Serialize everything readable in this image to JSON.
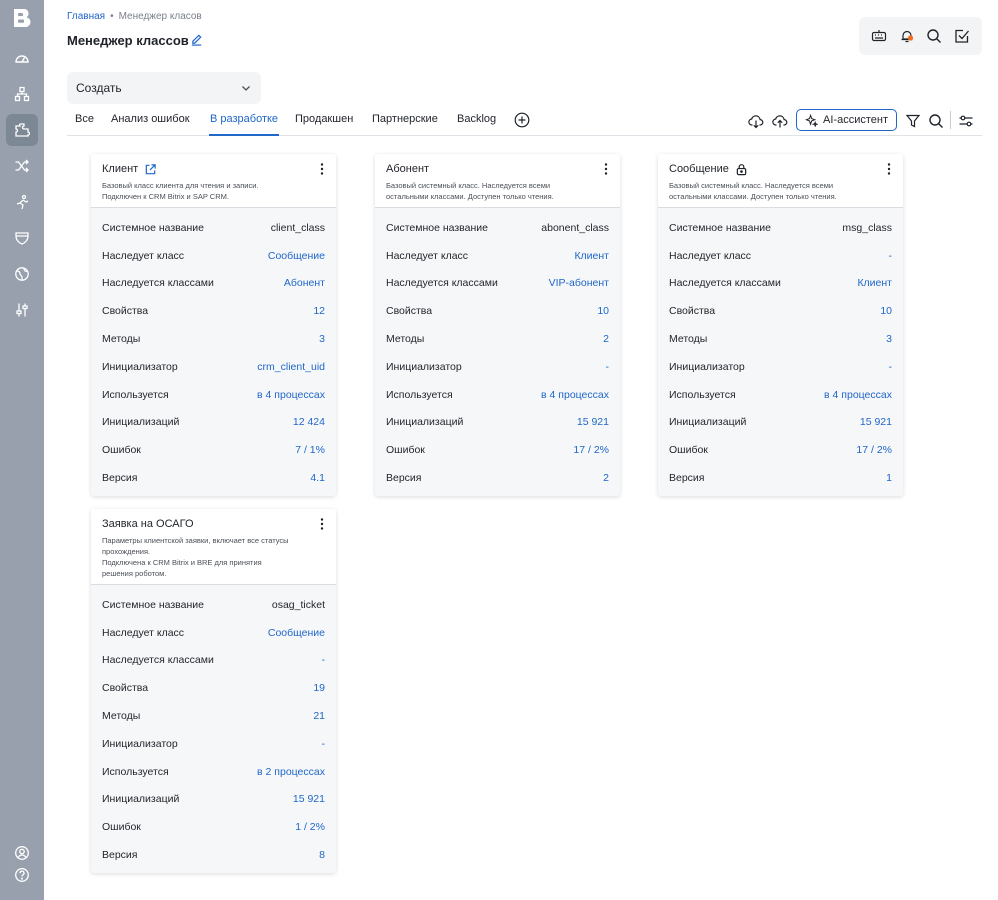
{
  "breadcrumb": {
    "home": "Главная",
    "separator": "•",
    "current": "Менеджер класов"
  },
  "page": {
    "title": "Менеджер классов"
  },
  "create": {
    "label": "Создать"
  },
  "tabs": [
    "Все",
    "Анализ ошибок",
    "В разработке",
    "Продакшен",
    "Партнерские",
    "Backlog"
  ],
  "active_tab": "В разработке",
  "toolbar": {
    "ai_label": "AI-ассистент"
  },
  "icons": {
    "sidebar": [
      "dashboard-icon",
      "structure-icon",
      "classes-icon",
      "shuffle-icon",
      "process-icon",
      "database-icon",
      "globe-icon",
      "settings-sliders-icon",
      "user-icon",
      "help-icon"
    ],
    "top": [
      "keyboard-icon",
      "notification-bell-icon",
      "search-icon",
      "task-check-icon"
    ]
  },
  "colors": {
    "accent": "#2067c9",
    "sidebar": "#97a0ac",
    "notification": "#f26b1d"
  },
  "row_labels": [
    "Системное название",
    "Наследует класс",
    "Наследуется классами",
    "Свойства",
    "Методы",
    "Инициализатор",
    "Используется",
    "Инициализаций",
    "Ошибок",
    "Версия"
  ],
  "cards": [
    {
      "title": "Клиент",
      "title_icon": "external-link-icon",
      "description": [
        "Базовый класс клиента для чтения и записи.",
        "Подключен к CRM Bitrix и SAP CRM."
      ],
      "values": [
        "client_class",
        "Сообщение",
        "Абонент",
        "12",
        "3",
        "crm_client_uid",
        "в 4 процессах",
        "12 424",
        "7 / 1%",
        "4.1"
      ]
    },
    {
      "title": "Абонент",
      "title_icon": "",
      "description": [
        "Базовый системный класс. Наследуется всеми",
        "остальными классами. Доступен только чтения."
      ],
      "values": [
        "abonent_class",
        "Клиент",
        "VIP-абонент",
        "10",
        "2",
        "-",
        "в 4 процессах",
        "15 921",
        "17 / 2%",
        "2"
      ]
    },
    {
      "title": "Сообщение",
      "title_icon": "lock-icon",
      "description": [
        "Базовый системный класс. Наследуется всеми",
        "остальными классами. Доступен только чтения."
      ],
      "values": [
        "msg_class",
        "-",
        "Клиент",
        "10",
        "3",
        "-",
        "в 4 процессах",
        "15 921",
        "17 / 2%",
        "1"
      ]
    },
    {
      "title": "Заявка на ОСАГО",
      "title_icon": "",
      "description": [
        "Параметры клиентской заявки, включает все статусы",
        "прохождения.",
        "Подключена к CRM Bitrix и BRE для принятия",
        "решения роботом."
      ],
      "values": [
        "osag_ticket",
        "Сообщение",
        "-",
        "19",
        "21",
        "-",
        "в 2 процессах",
        "15 921",
        "1 / 2%",
        "8"
      ]
    }
  ]
}
